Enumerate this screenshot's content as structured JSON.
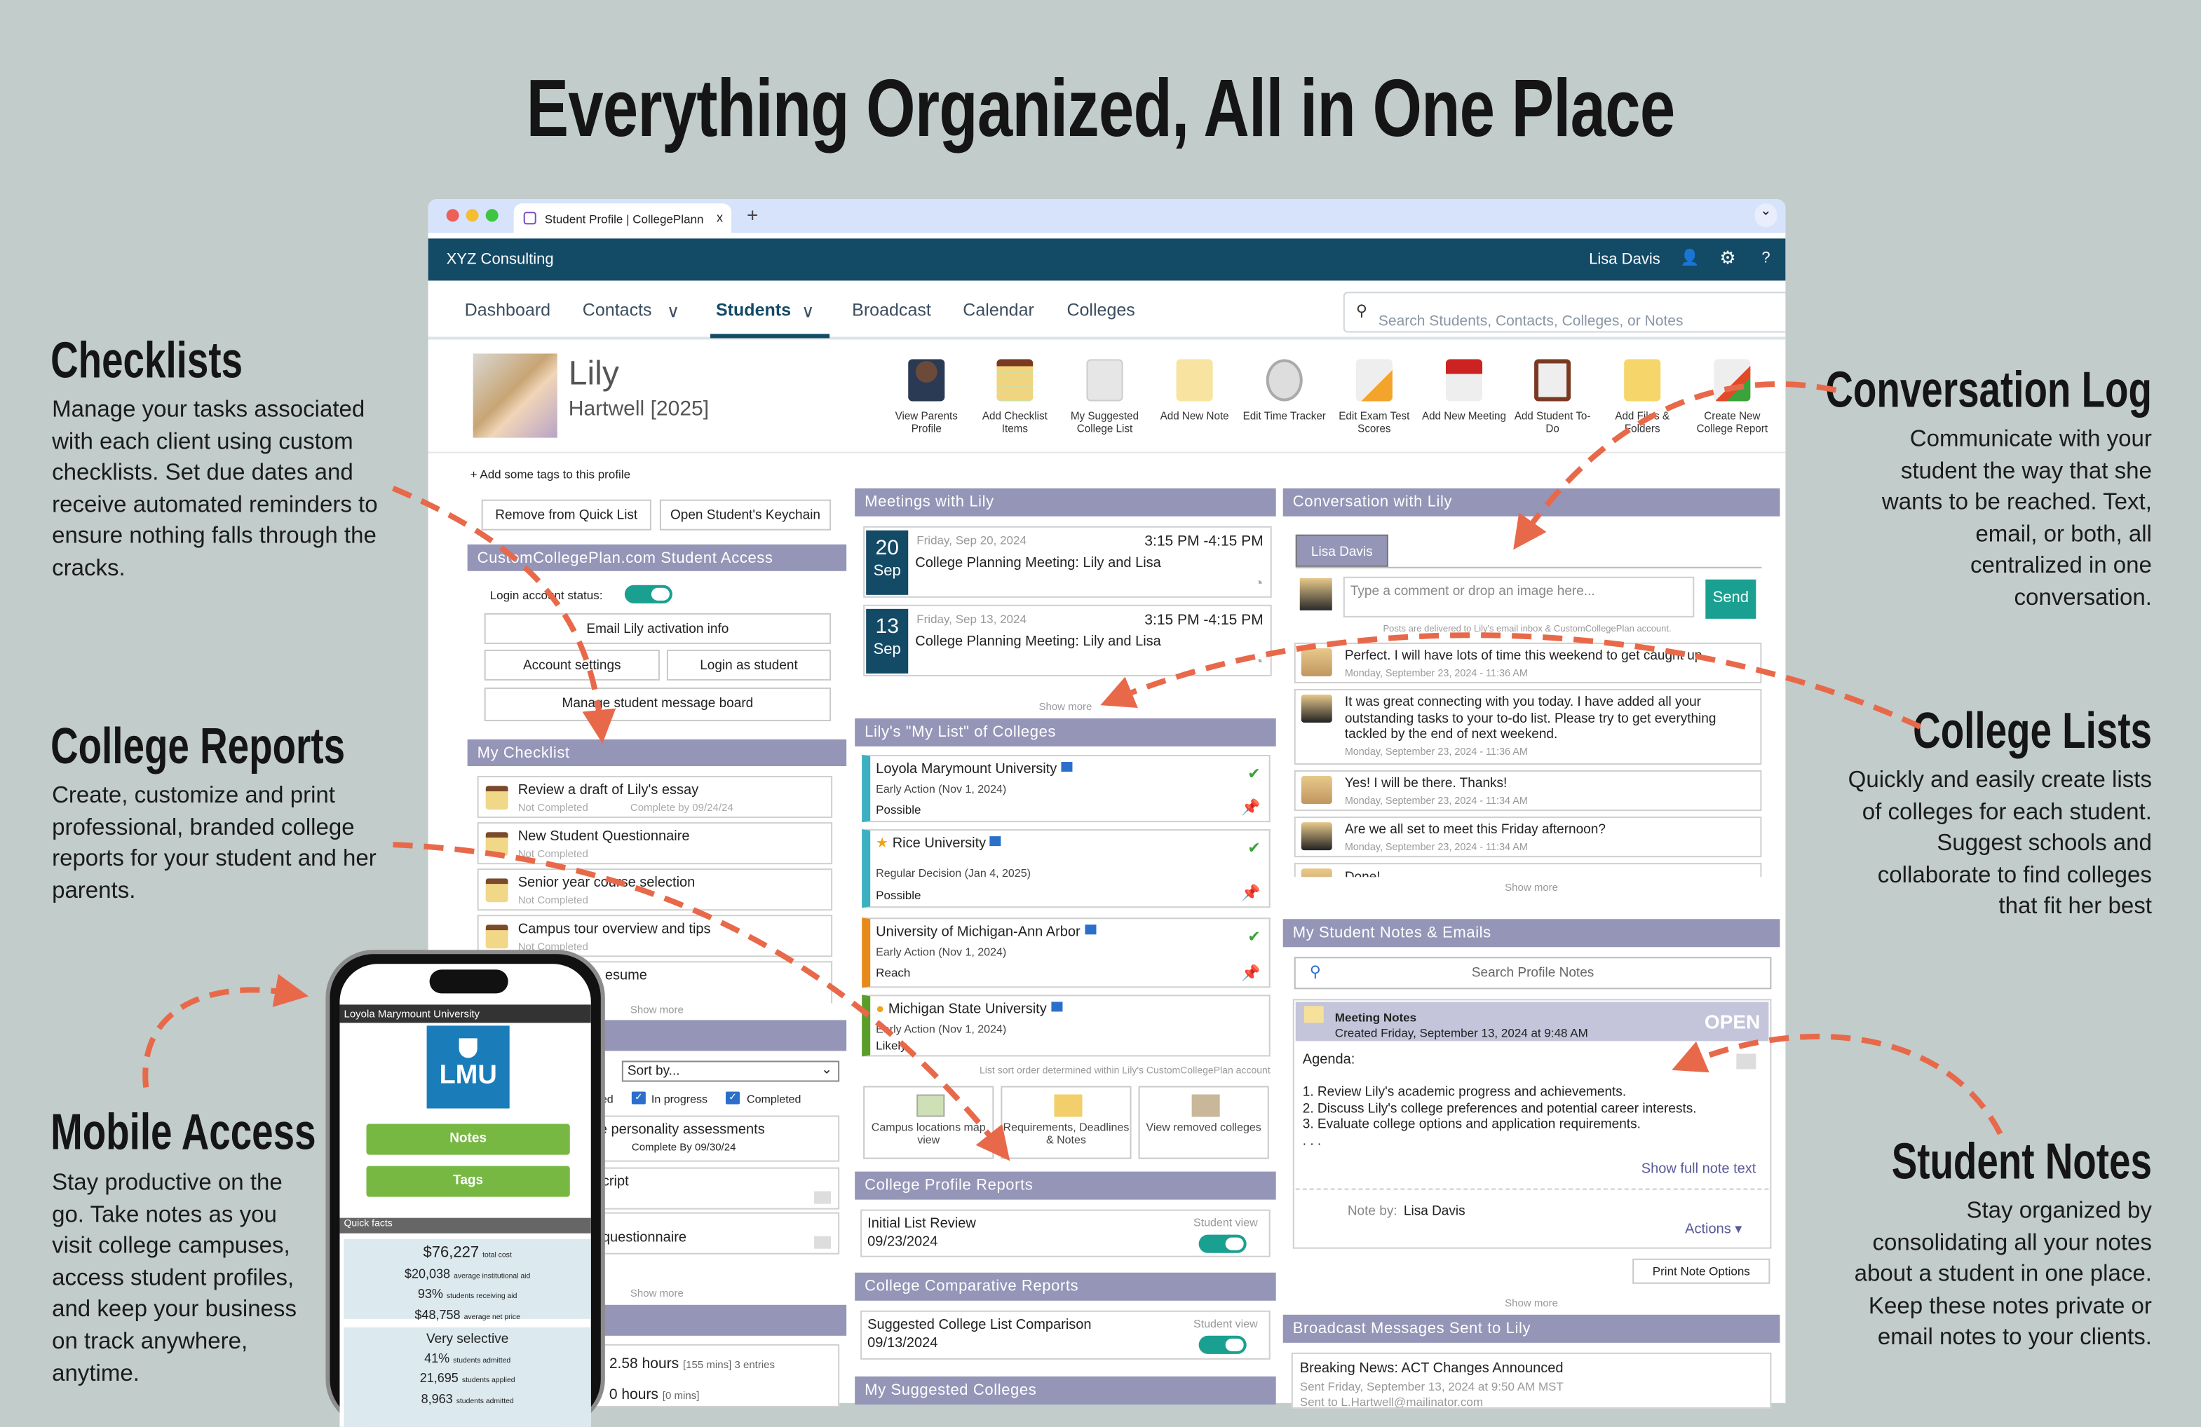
{
  "headline": "Everything Organized, All in One Place",
  "annotations": {
    "checklists": {
      "title": "Checklists",
      "body": "Manage your tasks associated with each client using custom checklists. Set due dates and receive automated reminders to ensure nothing falls through the cracks."
    },
    "college_reports": {
      "title": "College Reports",
      "body": "Create, customize and print professional, branded college reports for your student and her parents."
    },
    "mobile": {
      "title": "Mobile Access",
      "body": "Stay productive on the go. Take notes as you visit college campuses, access student profiles, and keep your business on track anywhere, anytime."
    },
    "conversation": {
      "title": "Conversation Log",
      "body": "Communicate with your student the way that she wants to be reached. Text, email, or both, all centralized in one conversation."
    },
    "college_lists": {
      "title": "College Lists",
      "body": "Quickly and easily create lists of colleges for each student. Suggest schools and collaborate to find colleges that fit her best"
    },
    "student_notes": {
      "title": "Student Notes",
      "body": "Stay organized by consolidating all your notes about a student in one place. Keep these notes private or email notes to your clients."
    }
  },
  "colors": {
    "header": "#134a66",
    "section": "#9595b8",
    "accent": "#1aa090",
    "arrow": "#e8694a",
    "background": "#c1cccb"
  },
  "browser": {
    "tab_title": "Student Profile | CollegePlann",
    "close": "x",
    "new_tab": "+",
    "menu": "⌄"
  },
  "header": {
    "org": "XYZ Consulting",
    "user": "Lisa Davis",
    "user_icon": "👤",
    "gear_icon": "⚙",
    "help": "?"
  },
  "nav": {
    "items": [
      "Dashboard",
      "Contacts",
      "Students",
      "Broadcast",
      "Calendar",
      "Colleges"
    ],
    "active": "Students",
    "chevron": "∨",
    "search_placeholder": "Search Students, Contacts, Colleges, or Notes"
  },
  "student": {
    "first": "Lily",
    "last": "Hartwell [2025]"
  },
  "toolbar": [
    "View Parents Profile",
    "Add Checklist Items",
    "My Suggested College List",
    "Add New Note",
    "Edit Time Tracker",
    "Edit Exam Test Scores",
    "Add New Meeting",
    "Add Student To-Do",
    "Add Files & Folders",
    "Create New College Report"
  ],
  "left": {
    "add_tags": "+ Add some tags to this profile",
    "remove_quick": "Remove from Quick List",
    "keychain": "Open Student's Keychain",
    "access_title": "CustomCollegePlan.com Student Access",
    "login_status": "Login account status:",
    "login_status_on": true,
    "email_activation": "Email Lily activation info",
    "account_settings": "Account settings",
    "login_as": "Login as student",
    "message_board": "Manage student message board",
    "checklist_title": "My Checklist",
    "checklist": [
      {
        "title": "Review a draft of Lily's essay",
        "status": "Not Completed",
        "due": "Complete by 09/24/24"
      },
      {
        "title": "New Student Questionnaire",
        "status": "Not Completed",
        "due": ""
      },
      {
        "title": "Senior year course selection",
        "status": "Not Completed",
        "due": ""
      },
      {
        "title": "Campus tour overview and tips",
        "status": "Not Completed",
        "due": ""
      },
      {
        "title": "esume",
        "status": "",
        "due": ""
      }
    ],
    "show_more": "Show more",
    "sort_by": "Sort by...",
    "filter_partial": "ed",
    "in_progress": "In progress",
    "completed": "Completed",
    "todos": [
      {
        "title": "e personality assessments",
        "due": "Complete By 09/30/24"
      },
      {
        "title": "cript"
      },
      {
        "title": "questionnaire"
      }
    ],
    "time": [
      {
        "hours": "2.58 hours",
        "detail": "[155 mins] 3 entries"
      },
      {
        "hours": "0 hours",
        "detail": "[0 mins]"
      }
    ]
  },
  "meetings": {
    "title": "Meetings with Lily",
    "items": [
      {
        "day": "20",
        "month": "Sep",
        "date": "Friday, Sep 20, 2024",
        "time": "3:15 PM -4:15 PM",
        "title": "College Planning Meeting: Lily and Lisa"
      },
      {
        "day": "13",
        "month": "Sep",
        "date": "Friday, Sep 13, 2024",
        "time": "3:15 PM -4:15 PM",
        "title": "College Planning Meeting: Lily and Lisa"
      }
    ],
    "show_more": "Show more"
  },
  "colleges": {
    "title": "Lily's \"My List\" of Colleges",
    "items": [
      {
        "name": "Loyola Marymount University",
        "deadline": "Early Action (Nov 1, 2024)",
        "fit": "Possible",
        "color": "#3ab0c0"
      },
      {
        "name": "Rice University",
        "deadline": "Regular Decision (Jan 4, 2025)",
        "fit": "Possible",
        "color": "#3ab0c0",
        "starred": true
      },
      {
        "name": "University of Michigan-Ann Arbor",
        "deadline": "Early Action (Nov 1, 2024)",
        "fit": "Reach",
        "color": "#e88a1a"
      },
      {
        "name": "Michigan State University",
        "deadline": "Early Action (Nov 1, 2024)",
        "fit": "Likely",
        "color": "#5a9e2a",
        "warning": true
      }
    ],
    "sort_note": "List sort order determined within Lily's CustomCollegePlan account",
    "buttons": [
      "Campus locations map view",
      "Requirements, Deadlines & Notes",
      "View removed colleges"
    ]
  },
  "profile_reports": {
    "title": "College Profile Reports",
    "item": "Initial List Review",
    "date": "09/23/2024",
    "student_view": "Student view",
    "on": true
  },
  "comparative_reports": {
    "title": "College Comparative Reports",
    "item": "Suggested College List Comparison",
    "date": "09/13/2024",
    "student_view": "Student view",
    "on": true
  },
  "suggested_title": "My Suggested Colleges",
  "conversation": {
    "title": "Conversation with Lily",
    "tab": "Lisa Davis",
    "placeholder": "Type a comment or drop an image here...",
    "send": "Send",
    "notice": "Posts are delivered to Lily's email inbox & CustomCollegePlan account.",
    "messages": [
      {
        "text": "Perfect. I will have lots of time this weekend to get caught up.",
        "time": "Monday, September 23, 2024 - 11:36 AM"
      },
      {
        "text": "It was great connecting with you today. I have added all your outstanding tasks to your to-do list. Please try to get everything tackled by the end of next weekend.",
        "time": "Monday, September 23, 2024 - 11:36 AM"
      },
      {
        "text": "Yes! I will be there. Thanks!",
        "time": "Monday, September 23, 2024 - 11:34 AM"
      },
      {
        "text": "Are we all set to meet this Friday afternoon?",
        "time": "Monday, September 23, 2024 - 11:34 AM"
      },
      {
        "text": "Done!",
        "time": ""
      }
    ],
    "show_more": "Show more"
  },
  "notes": {
    "title": "My Student Notes & Emails",
    "search": "Search Profile Notes",
    "note_title": "Meeting Notes",
    "created": "Created Friday, September 13, 2024 at 9:48 AM",
    "badge": "OPEN",
    "agenda": "Agenda:",
    "lines": [
      "1. Review Lily's academic progress and achievements.",
      "2. Discuss Lily's college preferences and potential career interests.",
      "3. Evaluate college options and application requirements.",
      ". . ."
    ],
    "show_full": "Show full note text",
    "note_by_label": "Note by:",
    "note_by": "Lisa Davis",
    "actions": "Actions ▾",
    "print": "Print Note Options",
    "show_more": "Show more"
  },
  "broadcast": {
    "title": "Broadcast Messages Sent to Lily",
    "item": "Breaking News: ACT Changes Announced",
    "sent": "Sent Friday, September 13, 2024 at 9:50 AM MST",
    "to": "Sent to L.Hartwell@mailinator.com"
  },
  "phone": {
    "college": "Loyola Marymount University",
    "logo": "LMU",
    "notes": "Notes",
    "tags": "Tags",
    "quick_facts": "Quick facts",
    "costs": [
      {
        "v": "$76,227",
        "l": "total cost"
      },
      {
        "v": "$20,038",
        "l": "average institutional aid"
      },
      {
        "v": "93%",
        "l": "students receiving aid"
      },
      {
        "v": "$48,758",
        "l": "average net price"
      }
    ],
    "selectivity": "Very selective",
    "admissions": [
      {
        "v": "41%",
        "l": "students admitted"
      },
      {
        "v": "21,695",
        "l": "students applied"
      },
      {
        "v": "8,963",
        "l": "students admitted"
      }
    ]
  }
}
